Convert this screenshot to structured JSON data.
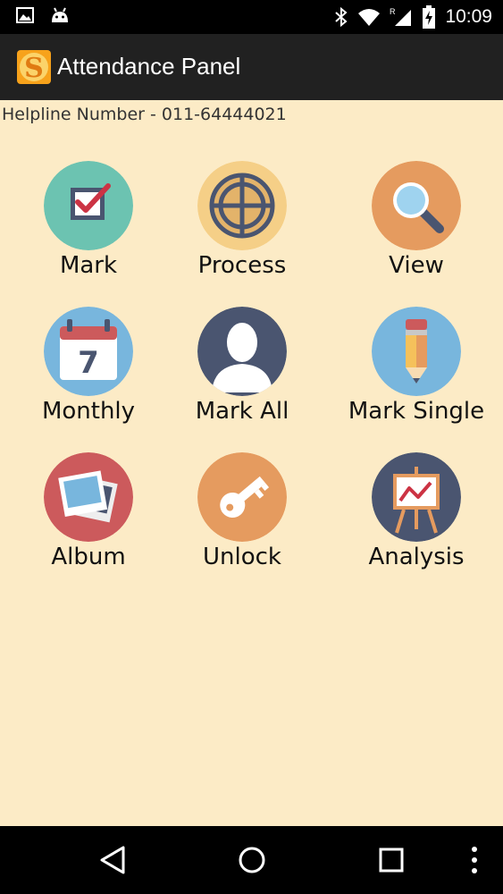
{
  "status_bar": {
    "time": "10:09",
    "icons": [
      "image-notification-icon",
      "android-notification-icon",
      "bluetooth-icon",
      "wifi-icon",
      "signal-icon",
      "battery-charging-icon"
    ]
  },
  "app_bar": {
    "title": "Attendance Panel",
    "logo": "app-logo-icon"
  },
  "helpline": "Helpline Number - 011-64444021",
  "tiles": [
    {
      "label": "Mark",
      "icon": "checkbox-icon",
      "color": "#6cc3b1"
    },
    {
      "label": "Process",
      "icon": "crosshair-icon",
      "color": "#f5cf87"
    },
    {
      "label": "View",
      "icon": "magnifier-icon",
      "color": "#e59b5f"
    },
    {
      "label": "Monthly",
      "icon": "calendar-icon",
      "color": "#78b6dd"
    },
    {
      "label": "Mark All",
      "icon": "user-silhouette-icon",
      "color": "#4a5570"
    },
    {
      "label": "Mark Single",
      "icon": "pencil-icon",
      "color": "#78b6dd"
    },
    {
      "label": "Album",
      "icon": "photos-icon",
      "color": "#cc5a5c"
    },
    {
      "label": "Unlock",
      "icon": "key-icon",
      "color": "#e59b5f"
    },
    {
      "label": "Analysis",
      "icon": "easel-chart-icon",
      "color": "#4a5570"
    }
  ],
  "calendar_day": "7",
  "nav_bar": {
    "icons": [
      "back-icon",
      "home-icon",
      "recents-icon",
      "more-icon"
    ]
  }
}
